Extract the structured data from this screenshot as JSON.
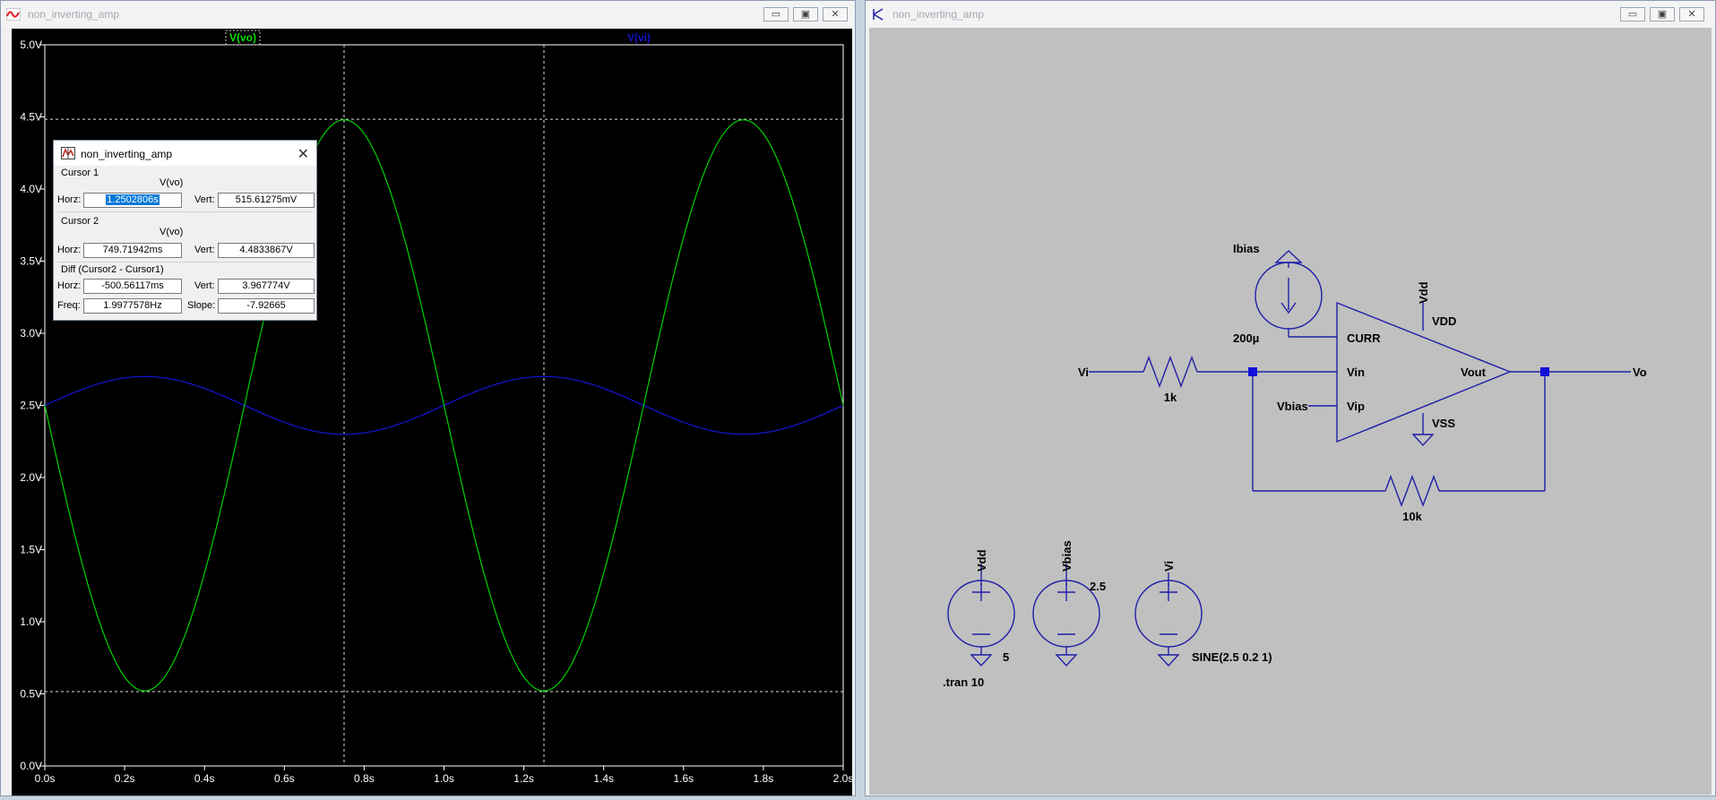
{
  "waveform_window": {
    "title": "non_inverting_amp",
    "buttons": [
      "▭",
      "▣",
      "✕"
    ]
  },
  "schematic_window": {
    "title": "non_inverting_amp",
    "buttons": [
      "▭",
      "▣",
      "✕"
    ]
  },
  "trace_labels": {
    "vo": "V(vo)",
    "vi": "V(vi)"
  },
  "colors": {
    "vo": "#00e000",
    "vi": "#1414c8",
    "cursor": "#e0e0e0",
    "axis_text": "#ffffff",
    "schematic_wire": "#1f1fa8",
    "junction": "#1010d8"
  },
  "chart_data": {
    "type": "line",
    "title": "",
    "xlabel": "",
    "ylabel": "",
    "xlim": [
      0,
      2
    ],
    "ylim": [
      0,
      5
    ],
    "x_ticks": [
      "0.0s",
      "0.2s",
      "0.4s",
      "0.6s",
      "0.8s",
      "1.0s",
      "1.2s",
      "1.4s",
      "1.6s",
      "1.8s",
      "2.0s"
    ],
    "y_ticks": [
      "0.0V",
      "0.5V",
      "1.0V",
      "1.5V",
      "2.0V",
      "2.5V",
      "3.0V",
      "3.5V",
      "4.0V",
      "4.5V",
      "5.0V"
    ],
    "series": [
      {
        "name": "V(vo)",
        "x": [
          0,
          0.1,
          0.25,
          0.4,
          0.5,
          0.6,
          0.75,
          0.9,
          1.0,
          1.1,
          1.25,
          1.4,
          1.5,
          1.6,
          1.75,
          1.9,
          2.0
        ],
        "values": [
          2.5,
          1.09,
          0.52,
          1.09,
          2.5,
          3.91,
          4.48,
          3.91,
          2.5,
          1.09,
          0.52,
          1.09,
          2.5,
          3.91,
          4.48,
          3.91,
          2.5
        ]
      },
      {
        "name": "V(vi)",
        "x": [
          0,
          0.1,
          0.25,
          0.4,
          0.5,
          0.6,
          0.75,
          0.9,
          1.0,
          1.1,
          1.25,
          1.4,
          1.5,
          1.6,
          1.75,
          1.9,
          2.0
        ],
        "values": [
          2.5,
          2.63,
          2.7,
          2.63,
          2.5,
          2.37,
          2.3,
          2.37,
          2.5,
          2.63,
          2.7,
          2.63,
          2.5,
          2.37,
          2.3,
          2.37,
          2.5
        ]
      }
    ],
    "cursors": {
      "vertical_x": [
        0.7497,
        1.2503
      ],
      "horizontal_y": [
        0.5156,
        4.4834
      ]
    }
  },
  "cursor_dialog": {
    "title": "non_inverting_amp",
    "cursor1": {
      "heading": "Cursor 1",
      "trace": "V(vo)",
      "horz_label": "Horz:",
      "horz": "1.2502806s",
      "vert_label": "Vert:",
      "vert": "515.61275mV"
    },
    "cursor2": {
      "heading": "Cursor 2",
      "trace": "V(vo)",
      "horz_label": "Horz:",
      "horz": "749.71942ms",
      "vert_label": "Vert:",
      "vert": "4.4833867V"
    },
    "diff": {
      "heading": "Diff (Cursor2 - Cursor1)",
      "horz_label": "Horz:",
      "horz": "-500.56117ms",
      "vert_label": "Vert:",
      "vert": "3.967774V",
      "freq_label": "Freq:",
      "freq": "1.9977578Hz",
      "slope_label": "Slope:",
      "slope": "-7.92665"
    }
  },
  "schematic": {
    "ibias": "Ibias",
    "ibias_value": "200µ",
    "vdd_net": "Vdd",
    "pin_vdd": "VDD",
    "pin_curr": "CURR",
    "pin_vin": "Vin",
    "pin_vip": "Vip",
    "pin_vout": "Vout",
    "pin_vss": "VSS",
    "vi_label": "Vi",
    "vo_label": "Vo",
    "vbias_label": "Vbias",
    "r1_value": "1k",
    "r2_value": "10k",
    "src_vdd_net": "Vdd",
    "src_vdd_value": "5",
    "src_vbias_net": "Vbias",
    "src_vbias_value": "2.5",
    "src_vi_net": "Vi",
    "src_vi_value": "SINE(2.5 0.2 1)",
    "directive": ".tran 10"
  }
}
